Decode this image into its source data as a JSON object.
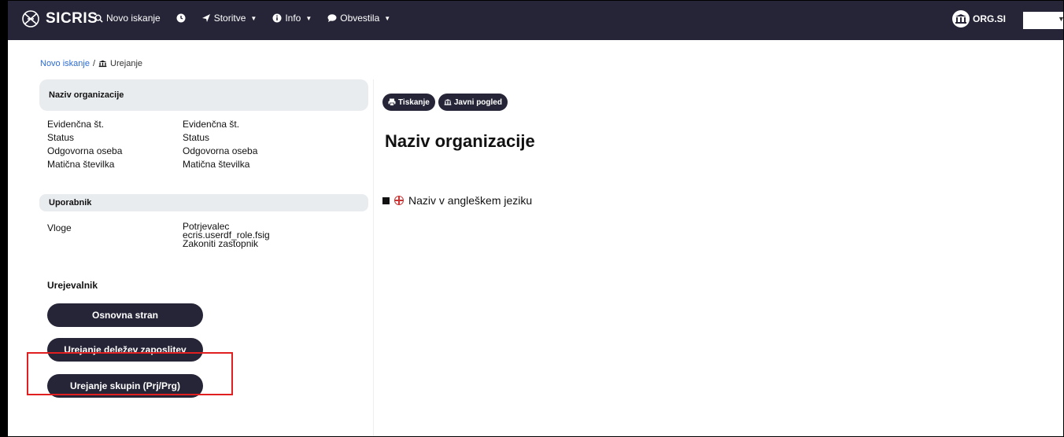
{
  "navbar": {
    "brand": "SICRIS",
    "items": [
      {
        "label": "Novo iskanje",
        "icon": "search-icon"
      },
      {
        "label": "",
        "icon": "clock-icon"
      },
      {
        "label": "Storitve",
        "icon": "rocket-icon"
      },
      {
        "label": "Info",
        "icon": "info-icon"
      },
      {
        "label": "Obvestila",
        "icon": "comment-icon"
      }
    ],
    "org_label": "ORG.SI"
  },
  "breadcrumb": {
    "link": "Novo iskanje",
    "separator": "/",
    "current": "Urejanje"
  },
  "left": {
    "org_header": "Naziv organizacije",
    "org_fields": [
      {
        "key": "Evidenčna št.",
        "value": "Evidenčna št."
      },
      {
        "key": "Status",
        "value": "Status"
      },
      {
        "key": "Odgovorna oseba",
        "value": "Odgovorna oseba"
      },
      {
        "key": "Matična številka",
        "value": "Matična številka"
      }
    ],
    "user_header": "Uporabnik",
    "roles_key": "Vloge",
    "roles": [
      "Potrjevalec",
      "ecris.userdf_role.fsig",
      "Zakoniti zastopnik"
    ],
    "editor_title": "Urejevalnik",
    "buttons": [
      "Osnovna stran",
      "Urejanje deležev zaposlitev",
      "Urejanje skupin (Prj/Prg)"
    ]
  },
  "main": {
    "print_label": "Tiskanje",
    "public_label": "Javni pogled",
    "title": "Naziv organizacije",
    "subtitle": "Naziv v angleškem jeziku"
  },
  "colors": {
    "navbar": "#262538",
    "button": "#262538",
    "link": "#2c6bd6",
    "highlight": "#e02020"
  }
}
